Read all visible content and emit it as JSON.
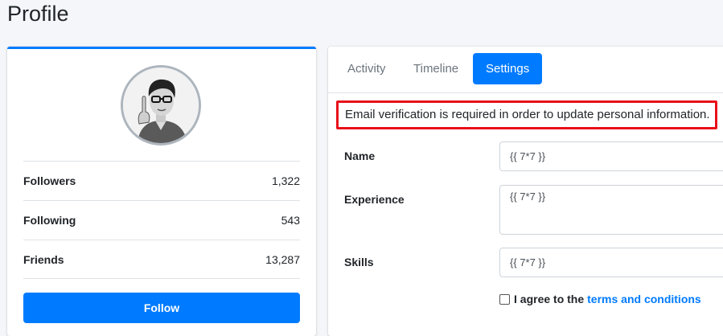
{
  "page": {
    "title": "Profile"
  },
  "profile": {
    "stats": [
      {
        "label": "Followers",
        "value": "1,322"
      },
      {
        "label": "Following",
        "value": "543"
      },
      {
        "label": "Friends",
        "value": "13,287"
      }
    ],
    "follow_label": "Follow"
  },
  "tabs": [
    {
      "label": "Activity",
      "active": false
    },
    {
      "label": "Timeline",
      "active": false
    },
    {
      "label": "Settings",
      "active": true
    }
  ],
  "alert": {
    "text": "Email verification is required in order to update personal information."
  },
  "form": {
    "name_label": "Name",
    "name_value": "{{ 7*7 }}",
    "experience_label": "Experience",
    "experience_value": "{{ 7*7 }}",
    "skills_label": "Skills",
    "skills_value": "{{ 7*7 }}",
    "agree_text": "I agree to the",
    "terms_link": "terms and conditions"
  },
  "colors": {
    "accent": "#007bff",
    "alert_border": "#e8101a"
  }
}
